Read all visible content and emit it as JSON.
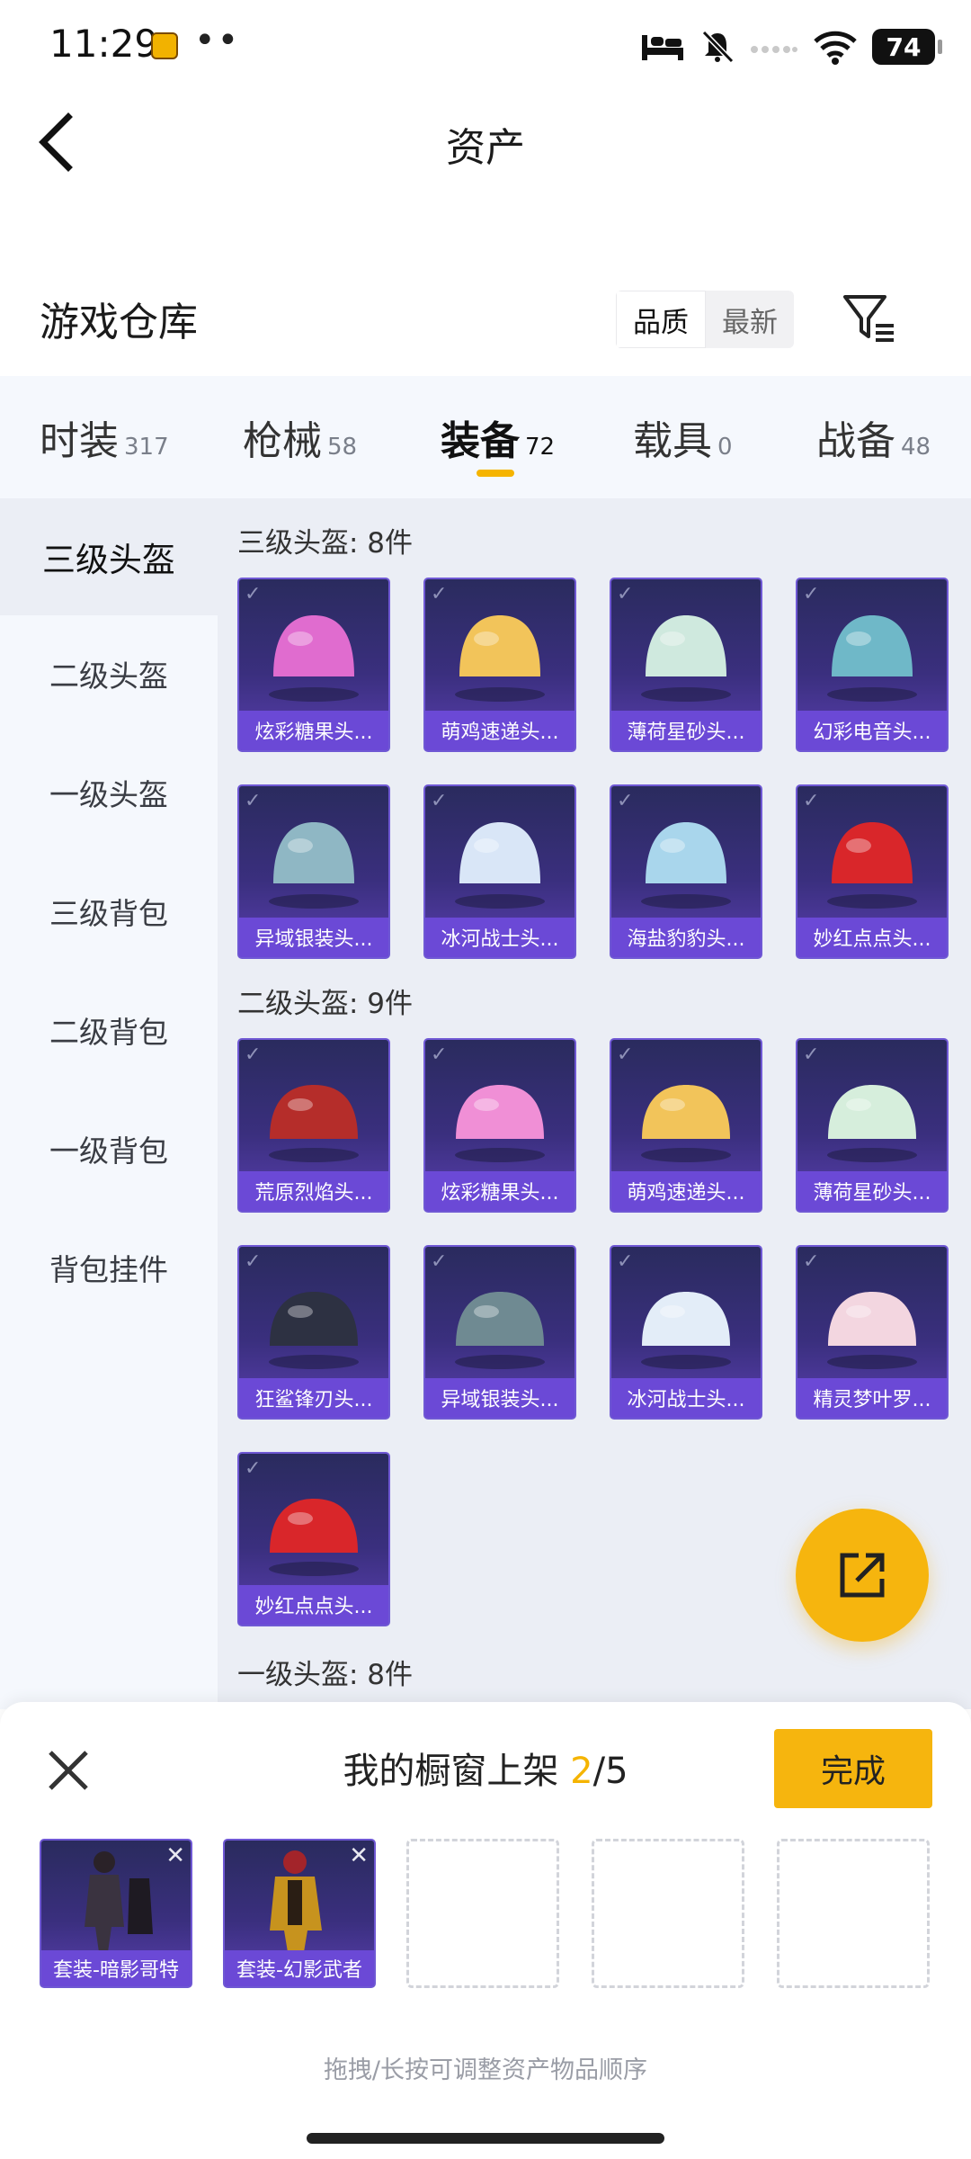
{
  "status_bar": {
    "time": "11:29",
    "dots": "••",
    "battery": "74"
  },
  "header": {
    "title": "资产"
  },
  "warehouse": {
    "title": "游戏仓库",
    "sort_options": [
      "品质",
      "最新"
    ]
  },
  "tabs": [
    {
      "label": "时装",
      "count": "317"
    },
    {
      "label": "枪械",
      "count": "58"
    },
    {
      "label": "装备",
      "count": "72"
    },
    {
      "label": "载具",
      "count": "0"
    },
    {
      "label": "战备",
      "count": "48"
    }
  ],
  "sidebar": {
    "items": [
      {
        "label": "三级头盔"
      },
      {
        "label": "二级头盔"
      },
      {
        "label": "一级头盔"
      },
      {
        "label": "三级背包"
      },
      {
        "label": "二级背包"
      },
      {
        "label": "一级背包"
      },
      {
        "label": "背包挂件"
      }
    ]
  },
  "sections": [
    {
      "title": "三级头盔: 8件",
      "items": [
        {
          "label": "炫彩糖果头...",
          "color": "#e06ccf"
        },
        {
          "label": "萌鸡速递头...",
          "color": "#f2c45a"
        },
        {
          "label": "薄荷星砂头...",
          "color": "#cfe9de"
        },
        {
          "label": "幻彩电音头...",
          "color": "#6fb8c8"
        },
        {
          "label": "异域银装头...",
          "color": "#8fb7c4"
        },
        {
          "label": "冰河战士头...",
          "color": "#d9e6f7"
        },
        {
          "label": "海盐豹豹头...",
          "color": "#a9d6ec"
        },
        {
          "label": "妙红点点头...",
          "color": "#d9262a"
        }
      ]
    },
    {
      "title": "二级头盔: 9件",
      "items": [
        {
          "label": "荒原烈焰头...",
          "color": "#b52d2a"
        },
        {
          "label": "炫彩糖果头...",
          "color": "#f08fd6"
        },
        {
          "label": "萌鸡速递头...",
          "color": "#f2c45a"
        },
        {
          "label": "薄荷星砂头...",
          "color": "#d6eedc"
        },
        {
          "label": "狂鲨锋刃头...",
          "color": "#2d3142"
        },
        {
          "label": "异域银装头...",
          "color": "#6f8a92"
        },
        {
          "label": "冰河战士头...",
          "color": "#e3edf8"
        },
        {
          "label": "精灵梦叶罗...",
          "color": "#f3d6e0"
        },
        {
          "label": "妙红点点头...",
          "color": "#d9262a"
        }
      ]
    },
    {
      "title": "一级头盔: 8件",
      "items": []
    }
  ],
  "showcase": {
    "title": "我的橱窗上架",
    "count_current": "2",
    "count_total": "/5",
    "done_label": "完成",
    "slots": [
      {
        "label": "套装-暗影哥特",
        "color": "#3a3340"
      },
      {
        "label": "套装-幻影武者",
        "color": "#c7931e"
      }
    ],
    "empty_slots": 3,
    "remove_glyph": "✕",
    "hint": "拖拽/长按可调整资产物品顺序"
  },
  "icons": {
    "back": "back-arrow-icon",
    "filter": "filter-icon",
    "share": "share-icon",
    "close": "close-icon",
    "check": "checkmark-icon"
  },
  "colors": {
    "accent": "#f6b50e",
    "card_border": "#6f58d4",
    "card_label_bg": "#6b49d6"
  }
}
